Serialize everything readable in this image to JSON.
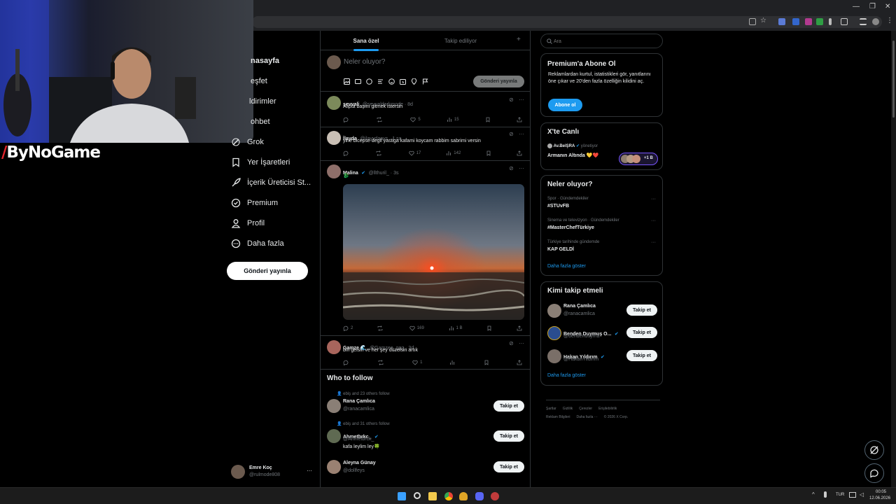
{
  "brand": {
    "logo_text": "ByNoGame"
  },
  "nav": {
    "items": [
      {
        "label": "nasayfa"
      },
      {
        "label": "eşfet"
      },
      {
        "label": "ldirimler"
      },
      {
        "label": "ohbet"
      },
      {
        "label": "Grok"
      },
      {
        "label": "Yer İşaretleri"
      },
      {
        "label": "İçerik Üreticisi St..."
      },
      {
        "label": "Premium"
      },
      {
        "label": "Profil"
      },
      {
        "label": "Daha fazla"
      }
    ],
    "post_button": "Gönderi yayınla",
    "account": {
      "name": "Emre Koç",
      "handle": "@rulmode808",
      "more": "···"
    }
  },
  "feed": {
    "tabs": [
      "Sana özel",
      "Takip ediliyor"
    ],
    "add_tab": "+",
    "composer": {
      "placeholder": "Neler oluyor?",
      "post_button": "Gönderi yayınla"
    },
    "tweets": [
      {
        "name": "şevvali",
        "handle": "@sevvaldarkmode · 8d",
        "text": "Alipta başını gitmek istersin",
        "replies": "",
        "retweets": "",
        "likes": "5",
        "views": "15"
      },
      {
        "name": "İlayda",
        "handle": "@ilayydaays · 1 sa",
        "text": "yine bicepse degil yastiga kafami koycam rabbim sabrimi versin",
        "replies": "",
        "retweets": "",
        "likes": "17",
        "views": "142"
      },
      {
        "name": "Malina",
        "handle": "@llthuril_ · 3s",
        "text": "🐉",
        "replies": "2",
        "retweets": "",
        "likes": "169",
        "views": "1 B"
      },
      {
        "name": "Gamze 🌊",
        "handle": "@Gamzee_ggg · 3d",
        "text": "biri gelsin ve her şey düzelsin artık",
        "replies": "",
        "retweets": "",
        "likes": "1",
        "views": ""
      }
    ],
    "who_to_follow": {
      "title": "Who to follow",
      "items": [
        {
          "context": "ebiş and 23 others follow",
          "name": "Rana Çamlıca",
          "handle": "@ranacamlica",
          "bio": "",
          "button": "Takip et"
        },
        {
          "context": "ebiş and 31 others follow",
          "name": "Ahmetbrkc_",
          "handle": "@Ahmetbrck_",
          "bio": "kafa leylim ley🍀",
          "button": "Takip et"
        },
        {
          "context": "",
          "name": "Aleyna Günay",
          "handle": "@dollfeys",
          "bio": "",
          "button": "Takip et"
        }
      ]
    }
  },
  "sidebar": {
    "search_placeholder": "Ara",
    "premium": {
      "title": "Premium'a Abone Ol",
      "text": "Reklamlardan kurtul, istatistikleri gör, yanıtlarını öne çıkar ve 20'den fazla özelliğin kilidini aç.",
      "button": "Abone ol"
    },
    "live": {
      "title": "X'te Canlı",
      "host": "Av.BelŞRA",
      "host_role": "yönetiyor",
      "topic": "Armanın Altında 💛❤️",
      "count": "+1 B"
    },
    "trends": {
      "title": "Neler oluyor?",
      "items": [
        {
          "category": "Spor · Gündemdekiler",
          "name": "#STUvFB"
        },
        {
          "category": "Sinema ve televizyon · Gündemdekiler",
          "name": "#MasterChefTürkiye"
        },
        {
          "category": "Türkiye tarihinde gündemde",
          "name": "KAP GELDİ"
        }
      ],
      "more": "Daha fazla göster"
    },
    "who_to_follow": {
      "title": "Kimi takip etmeli",
      "items": [
        {
          "name": "Rana Çamlıca",
          "handle": "@ranacamlica",
          "button": "Takip et"
        },
        {
          "name": "Benden Duymuş O...",
          "handle": "@bendenduyma",
          "button": "Takip et"
        },
        {
          "name": "Hakan Yıldırım",
          "handle": "@HakanYildirim",
          "button": "Takip et"
        }
      ],
      "more": "Daha fazla göster"
    },
    "footer": {
      "line1": [
        "Şartlar",
        "Gizlilik",
        "Çerezler",
        "Erişilebilirlik"
      ],
      "line2": [
        "Reklam Bilgileri",
        "Daha fazla ···",
        "© 2026 X Corp."
      ]
    }
  },
  "taskbar": {
    "lang": "TUR",
    "time": "00:05",
    "date": "12.06.2026"
  },
  "colors": {
    "accent": "#1d9bf0",
    "premium_button": "#1d9bf0",
    "bg": "#000000",
    "border": "#2f3336"
  }
}
